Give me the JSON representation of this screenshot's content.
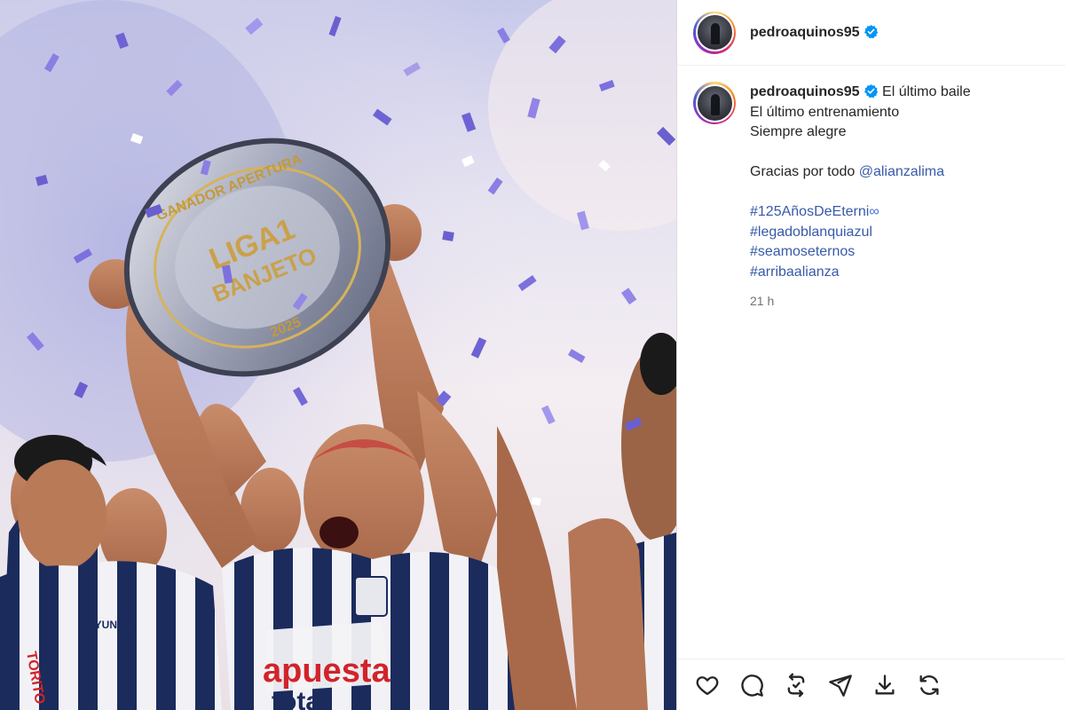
{
  "post": {
    "author": {
      "username": "pedroaquinos95",
      "verified": true
    },
    "photo": {
      "shield_text_top": "GANADOR APERTURA",
      "shield_text_main_1": "LIGA1",
      "shield_text_main_2": "BANJETO",
      "shield_year": "2025",
      "jersey_sponsor_1": "apuesta",
      "jersey_sponsor_2": "total",
      "left_sleeve_text": "TORITO",
      "chest_brand": "HYUNDAI"
    },
    "caption": {
      "lines": [
        "El último baile",
        "El último entrenamiento",
        "Siempre alegre"
      ],
      "thanks_text": "Gracias por todo",
      "mention": "@alianzalima",
      "hashtags": [
        "#125AñosDeEterni",
        "#legadoblanquiazul",
        "#seamoseternos",
        "#arribaalianza"
      ],
      "hashtag_emoji": "∞",
      "timestamp": "21 h"
    },
    "actions": {
      "like_icon": "heart-icon",
      "comment_icon": "comment-icon",
      "repost_icon": "repost-icon",
      "share_icon": "share-icon",
      "save_icon": "download-icon",
      "remix_icon": "refresh-icon"
    },
    "colors": {
      "verified_badge": "#0095f6",
      "link": "#385aa8",
      "timestamp": "#737373",
      "jersey_navy": "#1b2b5c"
    }
  }
}
